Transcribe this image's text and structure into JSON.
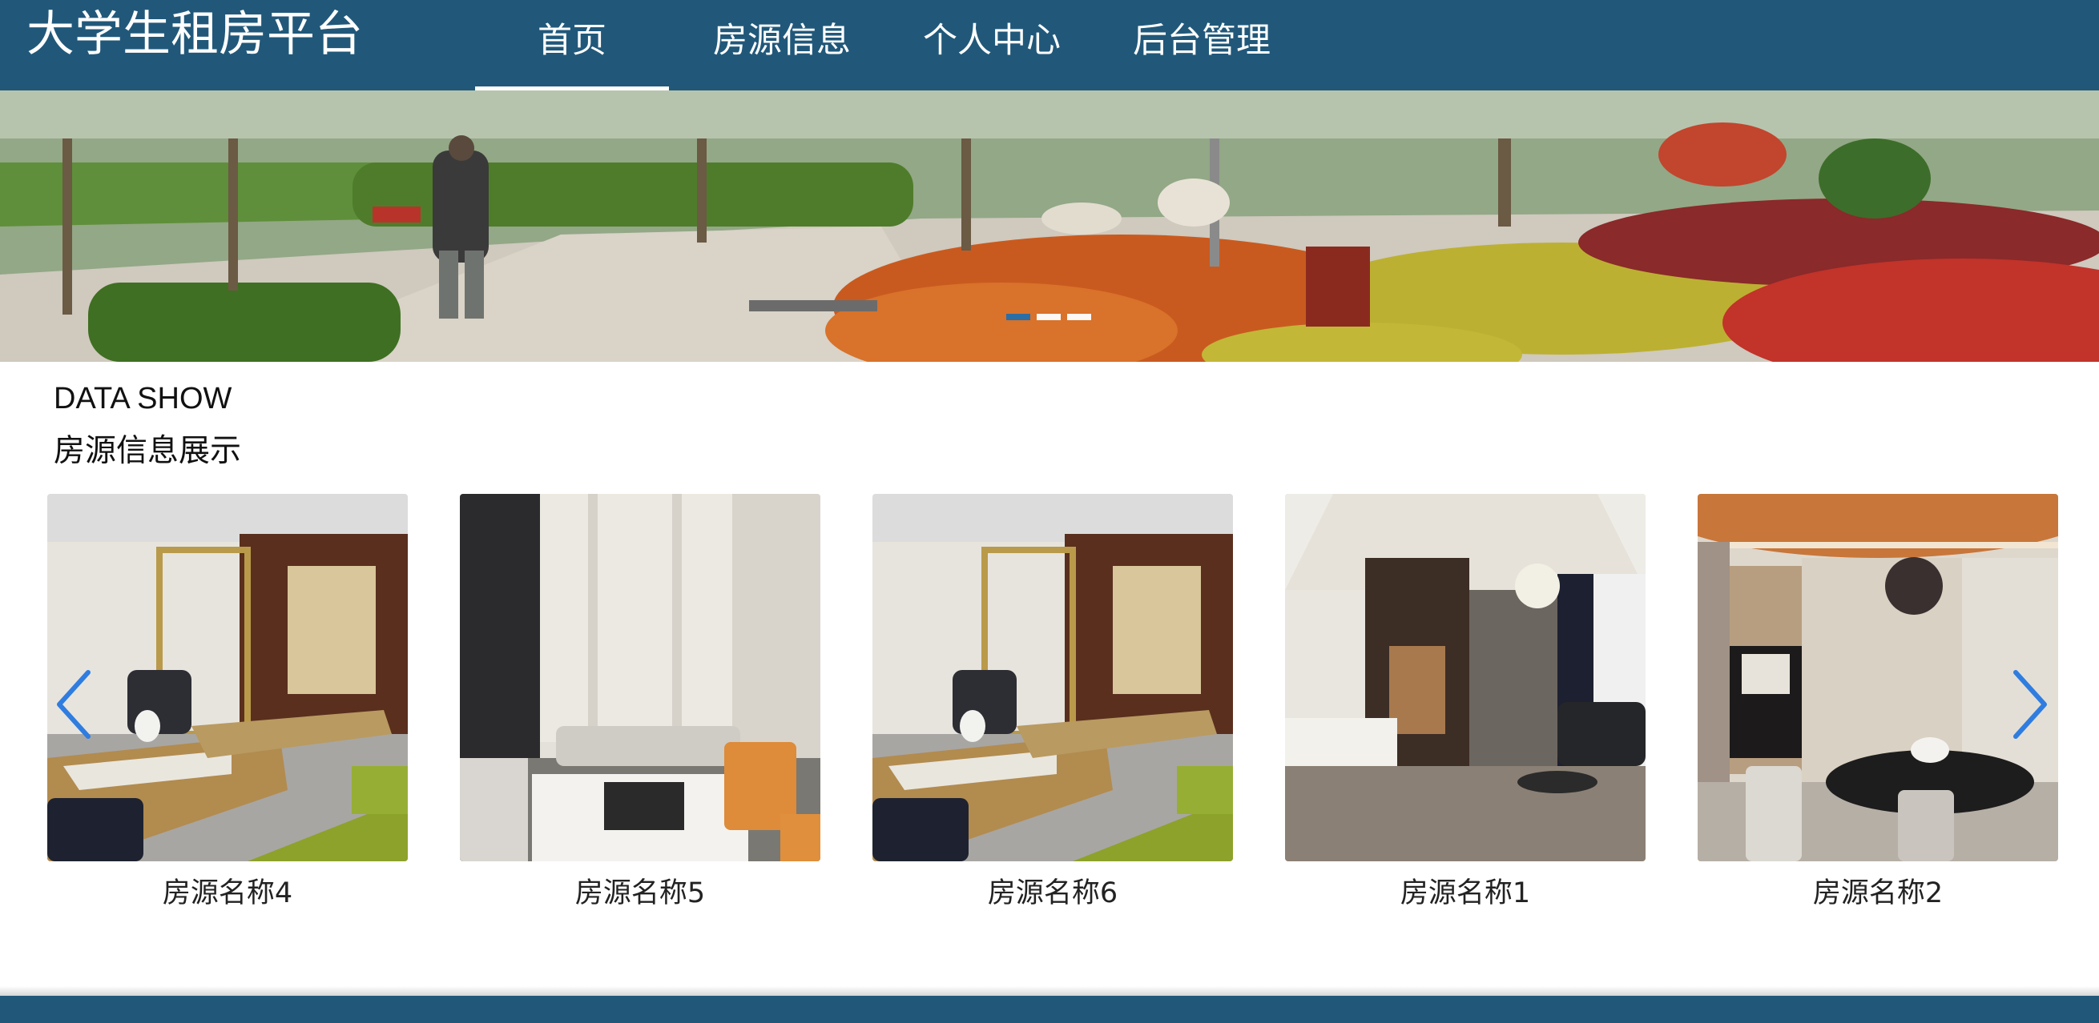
{
  "header": {
    "brand": "大学生租房平台",
    "nav": [
      {
        "label": "首页",
        "active": true
      },
      {
        "label": "房源信息",
        "active": false
      },
      {
        "label": "个人中心",
        "active": false
      },
      {
        "label": "后台管理",
        "active": false
      }
    ]
  },
  "banner": {
    "slide_count": 3,
    "active_slide": 1
  },
  "section": {
    "title_en": "DATA SHOW",
    "title_cn": "房源信息展示"
  },
  "listings": [
    {
      "name": "房源名称4"
    },
    {
      "name": "房源名称5"
    },
    {
      "name": "房源名称6"
    },
    {
      "name": "房源名称1"
    },
    {
      "name": "房源名称2"
    }
  ],
  "icons": {
    "prev": "chevron-left-icon",
    "next": "chevron-right-icon"
  },
  "colors": {
    "header_bg": "#21587a",
    "footer_bg": "#21587a",
    "dot_active": "#2b6ea6",
    "arrow": "#2f7de0"
  }
}
